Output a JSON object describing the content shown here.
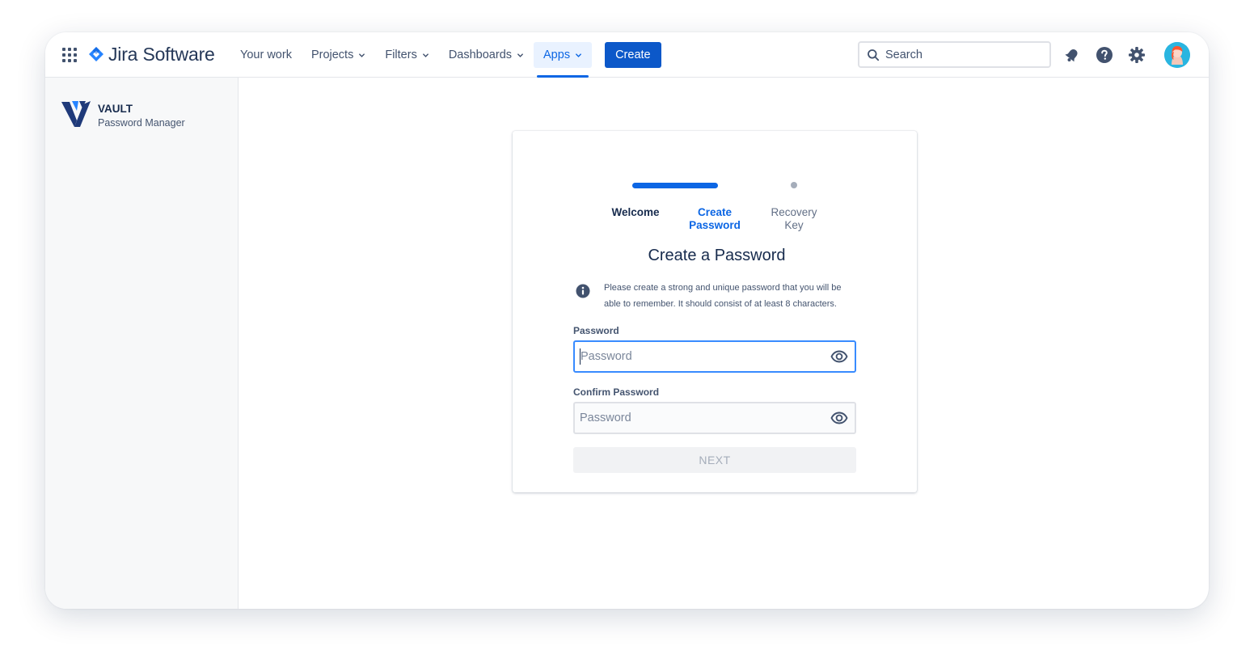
{
  "app": {
    "name": "Jira Software"
  },
  "nav": {
    "items": [
      {
        "label": "Your work",
        "dropdown": false
      },
      {
        "label": "Projects",
        "dropdown": true
      },
      {
        "label": "Filters",
        "dropdown": true
      },
      {
        "label": "Dashboards",
        "dropdown": true
      },
      {
        "label": "Apps",
        "dropdown": true,
        "active": true
      }
    ],
    "create_label": "Create"
  },
  "search": {
    "placeholder": "Search",
    "value": ""
  },
  "colors": {
    "primary": "#0c66e4",
    "create_button": "#0c58c9",
    "brand_dark": "#253858",
    "avatar": "#2ab5e0"
  },
  "sidebar": {
    "app_title": "VAULT",
    "app_subtitle": "Password Manager"
  },
  "wizard": {
    "steps": [
      {
        "label": "Welcome",
        "state": "completed"
      },
      {
        "label": "Create Password",
        "state": "current"
      },
      {
        "label": "Recovery Key",
        "state": "upcoming"
      }
    ],
    "title": "Create a Password",
    "info_text": "Please create a strong and unique password that you will be able to remember. It should consist of at least 8 characters.",
    "password_label": "Password",
    "password_placeholder": "Password",
    "password_value": "",
    "confirm_label": "Confirm Password",
    "confirm_placeholder": "Password",
    "confirm_value": "",
    "next_label": "NEXT"
  }
}
